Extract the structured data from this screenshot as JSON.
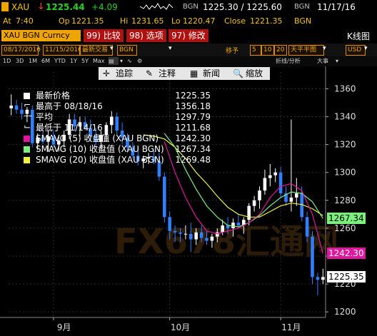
{
  "header": {
    "ticker": "XAU",
    "arrow": "↓",
    "last": "1225.44",
    "change": "+4.09",
    "source": "BGN",
    "bid_ask": "1225.30 / 1225.60",
    "source2": "BGN",
    "date": "11/17/16",
    "at_label": "At",
    "at_time": "7:40",
    "op_label": "Op",
    "op": "1221.35",
    "hi_label": "Hi",
    "hi": "1231.65",
    "lo_label": "Lo",
    "lo": "1220.47",
    "close_label": "Close",
    "close": "1221.35",
    "extra": "BGN"
  },
  "security_bar": {
    "name": "XAU BGN Curncy",
    "btn_compare": "99) 比较",
    "btn_options": "98) 选项",
    "btn_edit": "97) 修改",
    "chart_title": "K线图"
  },
  "range_bar": {
    "start_date": "08/17/2016",
    "end_date": "11/15/2016",
    "mode": "最新交易",
    "source": "BGN",
    "move_label": "移予",
    "periods": [
      "5",
      "10",
      "20"
    ],
    "period": "天平半图",
    "currency": "USD"
  },
  "timeframes": [
    "1D",
    "3D",
    "1M",
    "6M",
    "YTD",
    "1Y",
    "5Y",
    "Max"
  ],
  "view_tools": [
    "折线/分析",
    "大事"
  ],
  "toolbar": {
    "track": "追踪",
    "annotate": "注释",
    "news": "新闻",
    "zoom": "缩放"
  },
  "legend": [
    {
      "label": "最新价格",
      "value": "1225.35",
      "color": "#ffffff"
    },
    {
      "label": "最高于 08/18/16",
      "value": "1356.18",
      "color": ""
    },
    {
      "label": "平均",
      "value": "1297.79",
      "color": ""
    },
    {
      "label": "最低于 11/14/16",
      "value": "1211.68",
      "color": ""
    },
    {
      "label": "SMAVG (5) 收盘值 (XAU BGN)",
      "value": "1242.30",
      "color": "#e0169e"
    },
    {
      "label": "SMAVG (10) 收盘值 (XAU BGN)",
      "value": "1267.34",
      "color": "#7cf07c"
    },
    {
      "label": "SMAVG (20) 收盘值 (XAU BGN)",
      "value": "1269.48",
      "color": "#f0f040"
    }
  ],
  "price_labels": {
    "sma10": "1267.34",
    "sma5": "1242.30",
    "last": "1225.35"
  },
  "colors": {
    "amber": "#f0a400",
    "up_candle": "#ffffff",
    "down_candle": "#2f7fff",
    "sma5": "#e0169e",
    "sma10": "#7cf07c",
    "sma20": "#f0f040"
  },
  "watermark": "FX678汇通网",
  "chart_data": {
    "type": "candlestick",
    "y_ticks": [
      1200,
      1220,
      1240,
      1260,
      1280,
      1300,
      1320,
      1340,
      1360
    ],
    "ylim": [
      1196,
      1372
    ],
    "x_labels": [
      "9月",
      "10月",
      "11月"
    ],
    "x_label_index": [
      10,
      32,
      53
    ],
    "ohlc": [
      [
        1346,
        1356,
        1341,
        1348
      ],
      [
        1348,
        1352,
        1342,
        1345
      ],
      [
        1345,
        1350,
        1338,
        1342
      ],
      [
        1342,
        1347,
        1336,
        1345
      ],
      [
        1345,
        1348,
        1318,
        1321
      ],
      [
        1321,
        1328,
        1316,
        1325
      ],
      [
        1325,
        1330,
        1320,
        1322
      ],
      [
        1322,
        1330,
        1315,
        1326
      ],
      [
        1326,
        1330,
        1318,
        1320
      ],
      [
        1320,
        1326,
        1315,
        1323
      ],
      [
        1323,
        1330,
        1318,
        1327
      ],
      [
        1327,
        1342,
        1324,
        1338
      ],
      [
        1338,
        1342,
        1330,
        1333
      ],
      [
        1333,
        1340,
        1326,
        1336
      ],
      [
        1336,
        1340,
        1330,
        1332
      ],
      [
        1332,
        1338,
        1322,
        1326
      ],
      [
        1326,
        1332,
        1318,
        1322
      ],
      [
        1322,
        1330,
        1316,
        1327
      ],
      [
        1327,
        1336,
        1322,
        1334
      ],
      [
        1334,
        1344,
        1328,
        1340
      ],
      [
        1340,
        1343,
        1327,
        1330
      ],
      [
        1330,
        1336,
        1320,
        1325
      ],
      [
        1325,
        1328,
        1314,
        1318
      ],
      [
        1318,
        1322,
        1310,
        1312
      ],
      [
        1312,
        1318,
        1305,
        1308
      ],
      [
        1308,
        1312,
        1303,
        1310
      ],
      [
        1310,
        1314,
        1306,
        1311
      ],
      [
        1311,
        1316,
        1306,
        1308
      ],
      [
        1308,
        1314,
        1294,
        1297
      ],
      [
        1297,
        1300,
        1264,
        1268
      ],
      [
        1268,
        1272,
        1252,
        1258
      ],
      [
        1258,
        1262,
        1250,
        1257
      ],
      [
        1257,
        1260,
        1250,
        1256
      ],
      [
        1256,
        1262,
        1252,
        1256
      ],
      [
        1256,
        1264,
        1243,
        1252
      ],
      [
        1252,
        1260,
        1248,
        1257
      ],
      [
        1257,
        1262,
        1250,
        1253
      ],
      [
        1253,
        1258,
        1248,
        1251
      ],
      [
        1251,
        1256,
        1246,
        1254
      ],
      [
        1254,
        1260,
        1250,
        1257
      ],
      [
        1257,
        1266,
        1255,
        1262
      ],
      [
        1262,
        1268,
        1256,
        1260
      ],
      [
        1260,
        1267,
        1254,
        1264
      ],
      [
        1264,
        1270,
        1260,
        1262
      ],
      [
        1262,
        1268,
        1256,
        1266
      ],
      [
        1266,
        1278,
        1262,
        1276
      ],
      [
        1276,
        1283,
        1272,
        1280
      ],
      [
        1280,
        1290,
        1274,
        1287
      ],
      [
        1287,
        1302,
        1284,
        1296
      ],
      [
        1296,
        1306,
        1290,
        1298
      ],
      [
        1298,
        1303,
        1293,
        1300
      ],
      [
        1300,
        1304,
        1282,
        1285
      ],
      [
        1285,
        1290,
        1276,
        1279
      ],
      [
        1279,
        1338,
        1272,
        1282
      ],
      [
        1282,
        1296,
        1276,
        1285
      ],
      [
        1285,
        1290,
        1265,
        1268
      ],
      [
        1268,
        1272,
        1250,
        1254
      ],
      [
        1254,
        1258,
        1220,
        1225
      ],
      [
        1225,
        1228,
        1212,
        1223
      ],
      [
        1223,
        1231,
        1220,
        1225
      ]
    ],
    "sma5": [
      [
        29,
        1322
      ],
      [
        31,
        1300
      ],
      [
        33,
        1282
      ],
      [
        35,
        1268
      ],
      [
        37,
        1258
      ],
      [
        39,
        1256
      ],
      [
        41,
        1258
      ],
      [
        43,
        1260
      ],
      [
        45,
        1264
      ],
      [
        47,
        1270
      ],
      [
        49,
        1282
      ],
      [
        51,
        1290
      ],
      [
        53,
        1292
      ],
      [
        55,
        1287
      ],
      [
        57,
        1270
      ],
      [
        59,
        1242
      ]
    ],
    "sma10": [
      [
        29,
        1328
      ],
      [
        31,
        1318
      ],
      [
        33,
        1302
      ],
      [
        35,
        1288
      ],
      [
        37,
        1276
      ],
      [
        39,
        1268
      ],
      [
        41,
        1262
      ],
      [
        43,
        1261
      ],
      [
        45,
        1264
      ],
      [
        47,
        1269
      ],
      [
        49,
        1276
      ],
      [
        51,
        1282
      ],
      [
        53,
        1286
      ],
      [
        55,
        1285
      ],
      [
        57,
        1279
      ],
      [
        59,
        1267
      ]
    ],
    "sma20": [
      [
        25,
        1327
      ],
      [
        27,
        1326
      ],
      [
        29,
        1324
      ],
      [
        31,
        1318
      ],
      [
        33,
        1310
      ],
      [
        35,
        1300
      ],
      [
        37,
        1292
      ],
      [
        39,
        1283
      ],
      [
        41,
        1275
      ],
      [
        43,
        1270
      ],
      [
        45,
        1268
      ],
      [
        47,
        1268
      ],
      [
        49,
        1272
      ],
      [
        51,
        1276
      ],
      [
        53,
        1278
      ],
      [
        55,
        1277
      ],
      [
        57,
        1274
      ],
      [
        59,
        1269
      ]
    ]
  }
}
